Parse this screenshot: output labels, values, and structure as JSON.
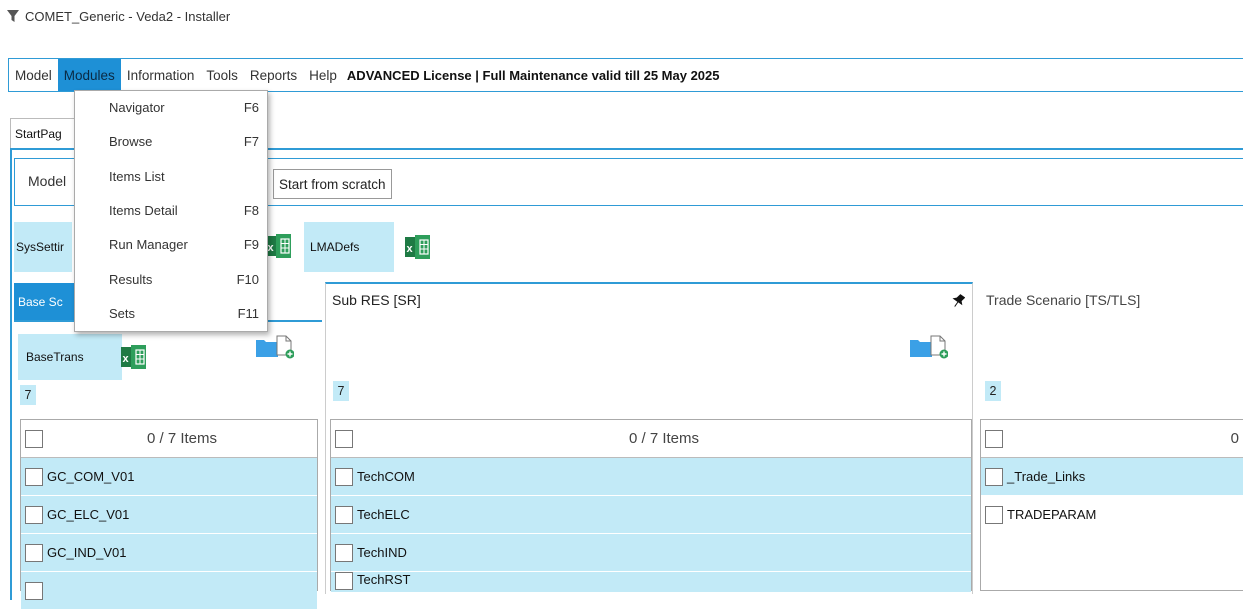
{
  "window": {
    "title": "COMET_Generic - Veda2 - Installer"
  },
  "menubar": {
    "items": [
      "Model",
      "Modules",
      "Information",
      "Tools",
      "Reports",
      "Help"
    ],
    "license": "ADVANCED License | Full Maintenance valid till 25 May 2025"
  },
  "modules_menu": {
    "items": [
      {
        "label": "Navigator",
        "shortcut": "F6"
      },
      {
        "label": "Browse",
        "shortcut": "F7"
      },
      {
        "label": "Items List",
        "shortcut": ""
      },
      {
        "label": "Items Detail",
        "shortcut": "F8"
      },
      {
        "label": "Run Manager",
        "shortcut": "F9"
      },
      {
        "label": "Results",
        "shortcut": "F10"
      },
      {
        "label": "Sets",
        "shortcut": "F11"
      }
    ]
  },
  "tabs": {
    "start": "StartPag"
  },
  "model_row": {
    "label": "Model",
    "start_button": "Start from scratch"
  },
  "chips": {
    "syssettings": "SysSettir",
    "lmadefs": "LMADefs",
    "basetrans": "BaseTrans"
  },
  "panels": {
    "base": {
      "tab": "Base Sc",
      "count": "7",
      "items_header": "0 / 7 Items",
      "rows": [
        "GC_COM_V01",
        "GC_ELC_V01",
        "GC_IND_V01"
      ]
    },
    "subres": {
      "title": "Sub RES [SR]",
      "count": "7",
      "items_header": "0 / 7 Items",
      "rows": [
        "TechCOM",
        "TechELC",
        "TechIND",
        "TechRST"
      ]
    },
    "trade": {
      "title": "Trade Scenario [TS/TLS]",
      "count": "2",
      "items_header": "0",
      "rows": [
        "_Trade_Links",
        "TRADEPARAM"
      ]
    }
  },
  "colors": {
    "accent": "#2f9bd6",
    "selection": "#c2eaf7",
    "excel": "#1e7a44"
  }
}
